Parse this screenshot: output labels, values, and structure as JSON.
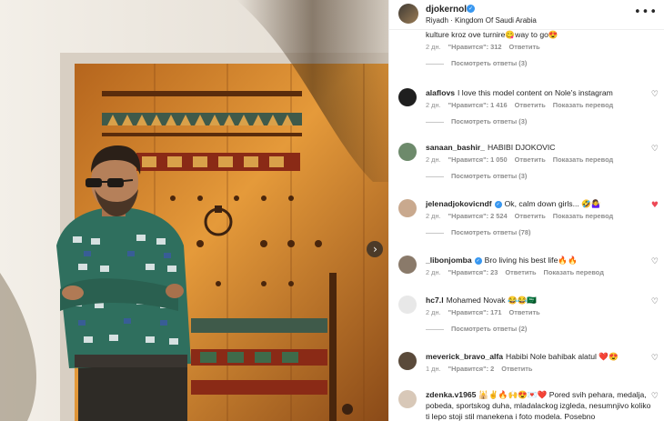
{
  "post": {
    "username": "djokernole",
    "location": "Riyadh · Kingdom Of Saudi Arabia",
    "more_icon": "more-horizontal-icon",
    "next_icon": "chevron-right-icon"
  },
  "comments": [
    {
      "username": "",
      "verified": false,
      "text": "kulture kroz ove turnire😋way to go😍",
      "age": "2 дн.",
      "likes": "\"Нравится\": 312",
      "reply": "Ответить",
      "translate": "",
      "replies": "Посмотреть ответы (3)",
      "liked": false,
      "avatar_color": "#b08968"
    },
    {
      "username": "alaflovs",
      "verified": false,
      "text": "I love this model content on Nole's instagram",
      "age": "2 дн.",
      "likes": "\"Нравится\": 1 416",
      "reply": "Ответить",
      "translate": "Показать перевод",
      "replies": "Посмотреть ответы (3)",
      "liked": false,
      "avatar_color": "#1f1f1f"
    },
    {
      "username": "sanaan_bashir_",
      "verified": false,
      "text": "HABIBI DJOKOVIC",
      "age": "2 дн.",
      "likes": "\"Нравится\": 1 050",
      "reply": "Ответить",
      "translate": "Показать перевод",
      "replies": "Посмотреть ответы (3)",
      "liked": false,
      "avatar_color": "#6d8a6b"
    },
    {
      "username": "jelenadjokovicndf",
      "verified": true,
      "text": "Ok, calm down girls... 🤣🤷‍♀️",
      "age": "2 дн.",
      "likes": "\"Нравится\": 2 524",
      "reply": "Ответить",
      "translate": "Показать перевод",
      "replies": "Посмотреть ответы (78)",
      "liked": true,
      "avatar_color": "#c9a98e"
    },
    {
      "username": "_libonjomba",
      "verified": true,
      "text": "Bro living his best life🔥🔥",
      "age": "2 дн.",
      "likes": "\"Нравится\": 23",
      "reply": "Ответить",
      "translate": "Показать перевод",
      "replies": "",
      "liked": false,
      "avatar_color": "#8a7a6a"
    },
    {
      "username": "hc7.l",
      "verified": false,
      "text": "Mohamed Novak 😂😂🇸🇦",
      "age": "2 дн.",
      "likes": "\"Нравится\": 171",
      "reply": "Ответить",
      "translate": "",
      "replies": "Посмотреть ответы (2)",
      "liked": false,
      "avatar_color": "#e8e8e8"
    },
    {
      "username": "meverick_bravo_alfa",
      "verified": false,
      "text": "Habibi Nole bahibak alatul ❤️😍",
      "age": "1 дн.",
      "likes": "\"Нравится\": 2",
      "reply": "Ответить",
      "translate": "",
      "replies": "",
      "liked": false,
      "avatar_color": "#5a4a3a"
    },
    {
      "username": "zdenka.v1965",
      "verified": false,
      "text": "🕌✌🔥🙌😍💌❤️ Pored svih pehara, medalja, pobeda, sportskog duha, mladalackog izgleda, nesumnjivo koliko ti lepo stoji stil manekena i foto modela. Posebno",
      "age": "",
      "likes": "",
      "reply": "",
      "translate": "",
      "replies": "",
      "liked": false,
      "avatar_color": "#d8c8b8"
    }
  ],
  "colors": {
    "accent": "#3897f0",
    "muted": "#8e8e8e",
    "liked": "#ed4956"
  },
  "icons": {
    "heart": "heart-icon",
    "verified": "verified-badge-icon"
  }
}
